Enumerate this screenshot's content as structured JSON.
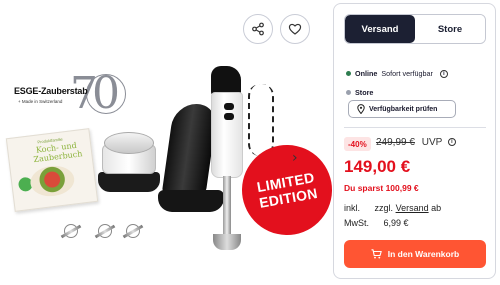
{
  "media": {
    "share_icon": "share-icon",
    "favorite_icon": "heart-icon",
    "next_icon": "chevron-right-icon",
    "next_glyph": "›",
    "logo": {
      "brand": "ESGE-Zauberstab",
      "sub": "+ Made in Switzerland",
      "number": "70"
    },
    "book": {
      "small_title": "Produktfamilie",
      "title": "Koch- und Zauberbuch"
    },
    "badge": {
      "line1": "LIMITED",
      "line2": "EDITION"
    }
  },
  "buybox": {
    "tabs": [
      {
        "label": "Versand",
        "active": true
      },
      {
        "label": "Store",
        "active": false
      }
    ],
    "availability": [
      {
        "label": "Online",
        "detail": "Sofort verfügbar",
        "color": "#2e7d4f"
      },
      {
        "label": "Store",
        "detail": "",
        "color": "#9aa0ad"
      }
    ],
    "check_button": "Verfügbarkeit prüfen",
    "discount": "-40%",
    "old_price": "249,99 €",
    "uvp": "UVP",
    "price": "149,00 €",
    "savings": "Du sparst 100,99 €",
    "shipping_label_1": "inkl.",
    "shipping_text_1": "zzgl.",
    "shipping_link": "Versand",
    "shipping_suffix": "ab",
    "shipping_label_2": "MwSt.",
    "shipping_cost": "6,99 €",
    "cart_button": "In den Warenkorb",
    "colors": {
      "primary_dark": "#1c2033",
      "accent_red": "#e3101d",
      "cta": "#ff5533"
    }
  }
}
